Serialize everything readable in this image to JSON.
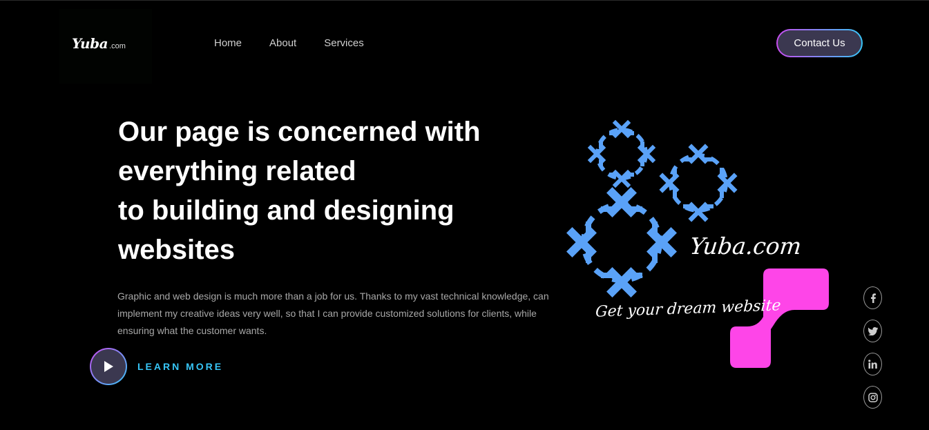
{
  "brand": {
    "logo_main": "Yuba",
    "logo_sub": ".com"
  },
  "nav": {
    "items": [
      {
        "label": "Home"
      },
      {
        "label": "About"
      },
      {
        "label": "Services"
      }
    ],
    "contact_label": "Contact Us"
  },
  "hero": {
    "headline_lines": [
      "Our page is concerned with",
      "everything related",
      "to building and designing",
      "websites"
    ],
    "description": "Graphic and web design is much more than a job for us. Thanks to my vast technical knowledge, can implement my creative ideas very well, so that I can provide customized solutions for clients, while ensuring what the customer wants.",
    "cta_label": "LEARN MORE"
  },
  "graphic": {
    "brand_name": "Yuba.com",
    "tagline": "Get your dream website",
    "colors": {
      "pattern": "#5aa2f8",
      "accent_shape": "#fe45e8"
    }
  },
  "social": [
    {
      "icon": "facebook-icon"
    },
    {
      "icon": "twitter-icon"
    },
    {
      "icon": "linkedin-icon"
    },
    {
      "icon": "instagram-icon"
    }
  ],
  "colors": {
    "background": "#000000",
    "accent_cyan": "#37c6f7",
    "accent_magenta": "#c94cf0",
    "button_fill": "#3b3850"
  }
}
